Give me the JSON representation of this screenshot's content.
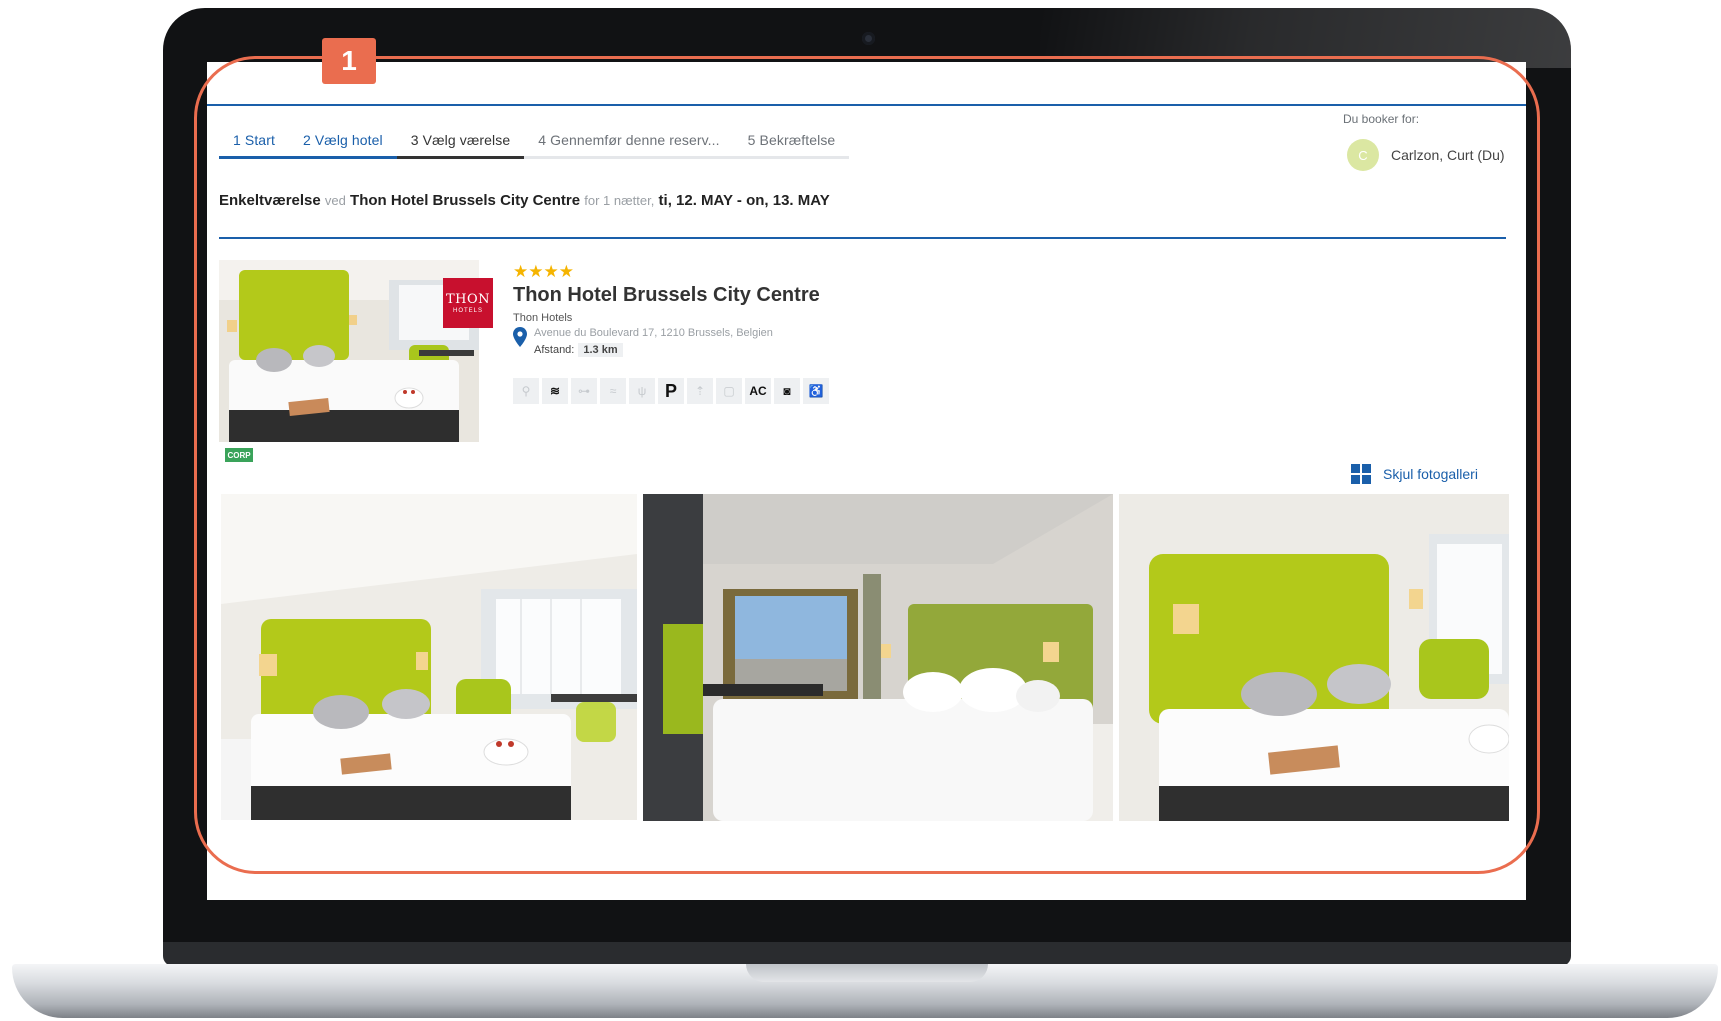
{
  "steps": [
    {
      "label": "1  Start",
      "state": "done"
    },
    {
      "label": "2  Vælg hotel",
      "state": "done"
    },
    {
      "label": "3  Vælg værelse",
      "state": "current"
    },
    {
      "label": "4  Gennemfør denne reserv...",
      "state": "todo"
    },
    {
      "label": "5  Bekræftelse",
      "state": "todo"
    }
  ],
  "booker": {
    "label": "Du booker for:",
    "initial": "C",
    "name": "Carlzon, Curt (Du)"
  },
  "summary": {
    "room_type": "Enkeltværelse",
    "at": "ved",
    "hotel": "Thon Hotel Brussels City Centre",
    "for_nights": "for 1 nætter,",
    "dates": "ti, 12. MAY - on, 13. MAY"
  },
  "hotel": {
    "stars": "★★★★",
    "name": "Thon Hotel Brussels City Centre",
    "chain": "Thon Hotels",
    "address": "Avenue du Boulevard 17, 1210 Brussels, Belgien",
    "distance_label": "Afstand:",
    "distance_value": "1.3 km",
    "logo_text": "THON",
    "logo_sub": "HOTELS",
    "badge": "CORP"
  },
  "amenities": [
    {
      "icon": "concierge-icon",
      "glyph": "⚲",
      "active": false
    },
    {
      "icon": "wifi-icon",
      "glyph": "≋",
      "active": true
    },
    {
      "icon": "gym-icon",
      "glyph": "⊶",
      "active": false
    },
    {
      "icon": "pool-icon",
      "glyph": "≈",
      "active": false
    },
    {
      "icon": "restaurant-icon",
      "glyph": "ψ",
      "active": false
    },
    {
      "icon": "parking-icon",
      "glyph": "P",
      "active": true
    },
    {
      "icon": "shuttle-icon",
      "glyph": "⇡",
      "active": false
    },
    {
      "icon": "minibar-icon",
      "glyph": "▢",
      "active": false
    },
    {
      "icon": "air-conditioning-icon",
      "glyph": "AC",
      "active": true
    },
    {
      "icon": "safe-icon",
      "glyph": "◙",
      "active": true
    },
    {
      "icon": "accessibility-icon",
      "glyph": "♿",
      "active": true
    }
  ],
  "gallery": {
    "toggle_label": "Skjul fotogalleri"
  },
  "annotation": {
    "number": "1"
  },
  "colors": {
    "accent": "#1a5faa",
    "star": "#f5b400",
    "annotation": "#ea6d4f",
    "thon_red": "#c8102e",
    "corp_green": "#3aa35a",
    "headboard_green": "#b3c91a"
  }
}
